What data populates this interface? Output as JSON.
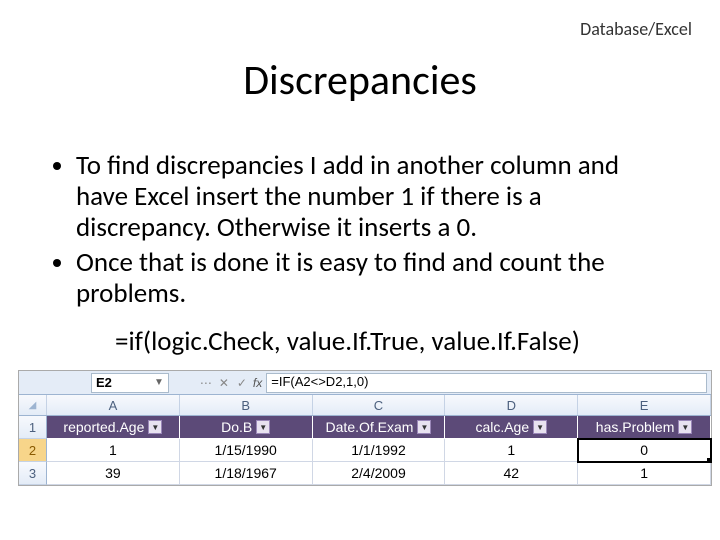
{
  "top_label": "Database/Excel",
  "title": "Discrepancies",
  "bullet1": "To find discrepancies I add in another column and have Excel insert the number 1 if there is a discrepancy.  Otherwise it inserts a 0.",
  "bullet2": "Once that is done it is easy to find and count the problems.",
  "formula_line": "=if(logic.Check, value.If.True, value.If.False)",
  "excel": {
    "namebox": "E2",
    "fx_value": "=IF(A2<>D2,1,0)",
    "col_headers": [
      "A",
      "B",
      "C",
      "D",
      "E"
    ],
    "table_headers": [
      "reported.Age",
      "Do.B",
      "Date.Of.Exam",
      "calc.Age",
      "has.Problem"
    ],
    "rows": [
      {
        "n": "1"
      },
      {
        "n": "2",
        "cells": [
          "1",
          "1/15/1990",
          "1/1/1992",
          "1",
          "0"
        ]
      },
      {
        "n": "3",
        "cells": [
          "39",
          "1/18/1967",
          "2/4/2009",
          "42",
          "1"
        ]
      }
    ]
  }
}
